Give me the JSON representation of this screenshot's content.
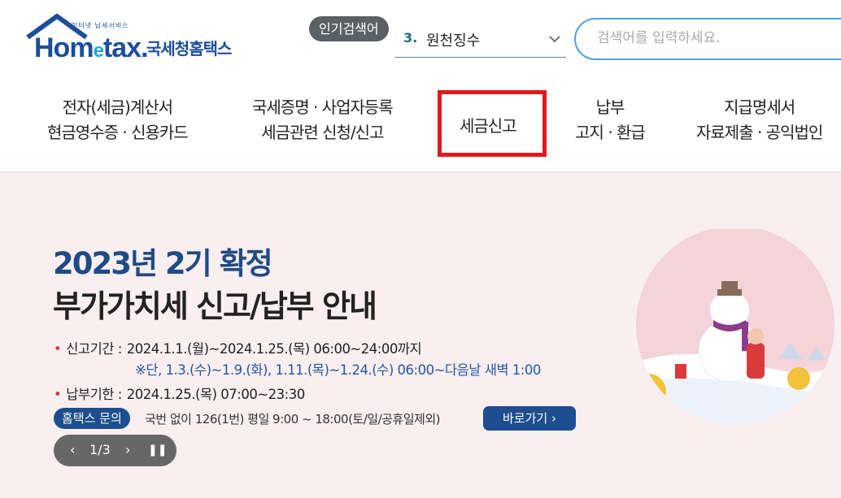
{
  "logo": {
    "small_text": "인터넷 납세서비스",
    "brand": "Hometax",
    "brand_pre": "Hom",
    "brand_e": "e",
    "brand_post": "tax.",
    "korean_name": "국세청홈택스"
  },
  "popular_search": {
    "badge": "인기검색어",
    "rank": "3.",
    "keyword": "원천징수",
    "dropdown_icon": "chevron-down-icon"
  },
  "search": {
    "placeholder": "검색어를 입력하세요."
  },
  "nav": {
    "items": [
      {
        "line1": "전자(세금)계산서",
        "line2": "현금영수증 · 신용카드"
      },
      {
        "line1": "국세증명 · 사업자등록",
        "line2": "세금관련 신청/신고"
      },
      {
        "line1": "세금신고",
        "line2": ""
      },
      {
        "line1": "납부",
        "line2": "고지 · 환급"
      },
      {
        "line1": "지급명세서",
        "line2": "자료제출 · 공익법인"
      }
    ],
    "highlight_color": "#e0191f"
  },
  "banner": {
    "title1": "2023년 2기 확정",
    "title2": "부가가치세 신고/납부 안내",
    "filing_label": "신고기간 :",
    "filing_value": "2024.1.1.(월)~2024.1.25.(목) 06:00~24:00까지",
    "filing_note": "※단, 1.3.(수)~1.9.(화), 1.11.(목)~1.24.(수) 06:00~다음날 새벽 1:00",
    "payment_label": "납부기한 :",
    "payment_value": "2024.1.25.(목) 07:00~23:30",
    "inquiry_badge": "홈택스 문의",
    "inquiry_text": "국번 없이 126(1번) 평일 9:00 ~ 18:00(토/일/공휴일제외)",
    "go_button": "바로가기",
    "go_icon": "chevron-right-icon",
    "pager": {
      "current": "1",
      "separator": "/",
      "total": "3",
      "display": "1/3"
    },
    "accent_color": "#1d4e8f",
    "background_color": "#f9eef0"
  }
}
